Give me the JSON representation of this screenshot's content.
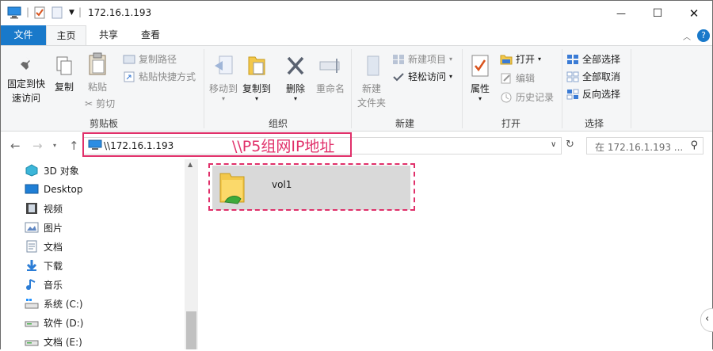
{
  "window": {
    "title": "172.16.1.193",
    "controls": {
      "minimize": "—",
      "maximize": "☐",
      "close": "✕"
    }
  },
  "ribbon_tabs": [
    "文件",
    "主页",
    "共享",
    "查看"
  ],
  "ribbon": {
    "clipboard": {
      "pin_line1": "固定到快",
      "pin_line2": "速访问",
      "copy": "复制",
      "paste": "粘贴",
      "copy_path": "复制路径",
      "paste_shortcut": "粘贴快捷方式",
      "cut": "剪切",
      "label": "剪贴板"
    },
    "organize": {
      "move_to": "移动到",
      "copy_to": "复制到",
      "delete": "删除",
      "rename": "重命名",
      "label": "组织"
    },
    "new": {
      "new_folder_line1": "新建",
      "new_folder_line2": "文件夹",
      "new_item": "新建项目",
      "easy_access": "轻松访问",
      "label": "新建"
    },
    "open": {
      "properties": "属性",
      "open": "打开",
      "edit": "编辑",
      "history": "历史记录",
      "label": "打开"
    },
    "select": {
      "select_all": "全部选择",
      "select_none": "全部取消",
      "invert": "反向选择",
      "label": "选择"
    }
  },
  "address": {
    "path": "\\\\172.16.1.193",
    "annotation": "\\\\P5组网IP地址",
    "search_placeholder": "在 172.16.1.193 ..."
  },
  "nav_items": [
    {
      "label": "3D 对象",
      "icon": "3d-objects-icon"
    },
    {
      "label": "Desktop",
      "icon": "desktop-icon"
    },
    {
      "label": "视频",
      "icon": "video-icon"
    },
    {
      "label": "图片",
      "icon": "pictures-icon"
    },
    {
      "label": "文档",
      "icon": "documents-icon"
    },
    {
      "label": "下载",
      "icon": "downloads-icon"
    },
    {
      "label": "音乐",
      "icon": "music-icon"
    },
    {
      "label": "系统 (C:)",
      "icon": "drive-icon"
    },
    {
      "label": "软件 (D:)",
      "icon": "drive-icon"
    },
    {
      "label": "文档 (E:)",
      "icon": "drive-icon"
    }
  ],
  "files": [
    {
      "name": "vol1",
      "icon": "shared-folder-icon"
    }
  ],
  "colors": {
    "accent": "#1979ca",
    "annotation": "#e0306a"
  }
}
